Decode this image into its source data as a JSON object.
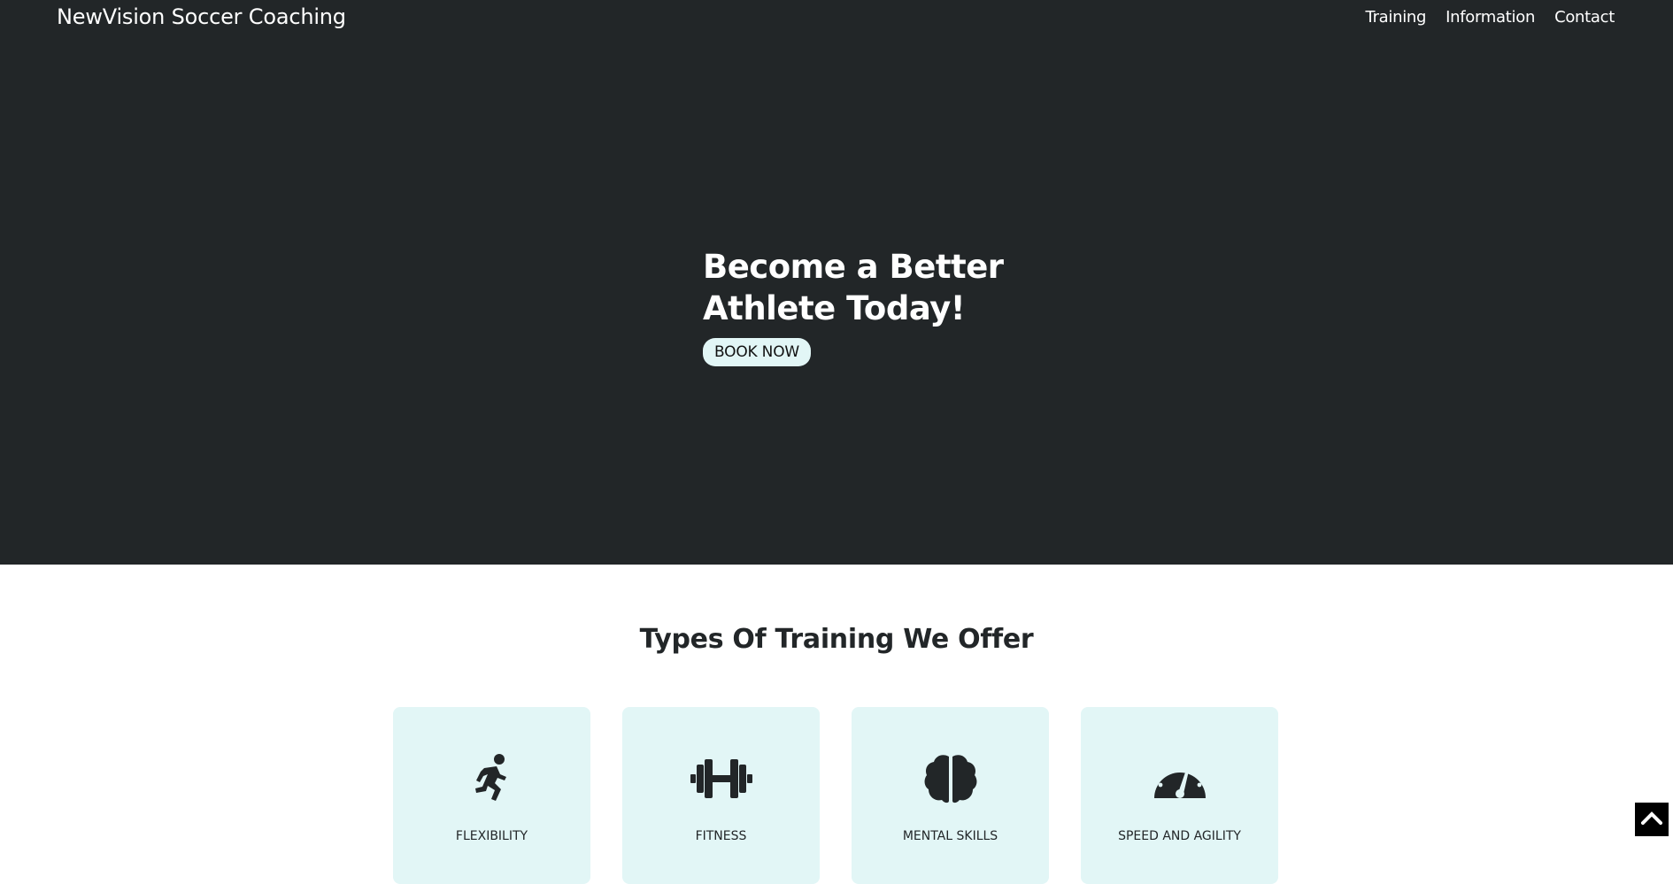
{
  "header": {
    "brand": "NewVision Soccer Coaching",
    "nav": [
      "Training",
      "Information",
      "Contact"
    ]
  },
  "hero": {
    "title_line1": "Become a Better",
    "title_line2": "Athlete Today!",
    "cta_label": "BOOK NOW"
  },
  "training": {
    "title": "Types Of Training We Offer",
    "cards": [
      {
        "label": "FLEXIBILITY",
        "icon": "running-person-icon"
      },
      {
        "label": "FITNESS",
        "icon": "dumbbell-icon"
      },
      {
        "label": "MENTAL SKILLS",
        "icon": "brain-icon"
      },
      {
        "label": "SPEED AND AGILITY",
        "icon": "speedometer-icon"
      }
    ]
  },
  "colors": {
    "hero_bg": "#222628",
    "card_bg": "#e2f6f6",
    "accent": "#e2f6f6"
  },
  "scroll_top": {
    "icon": "chevron-up-icon"
  }
}
